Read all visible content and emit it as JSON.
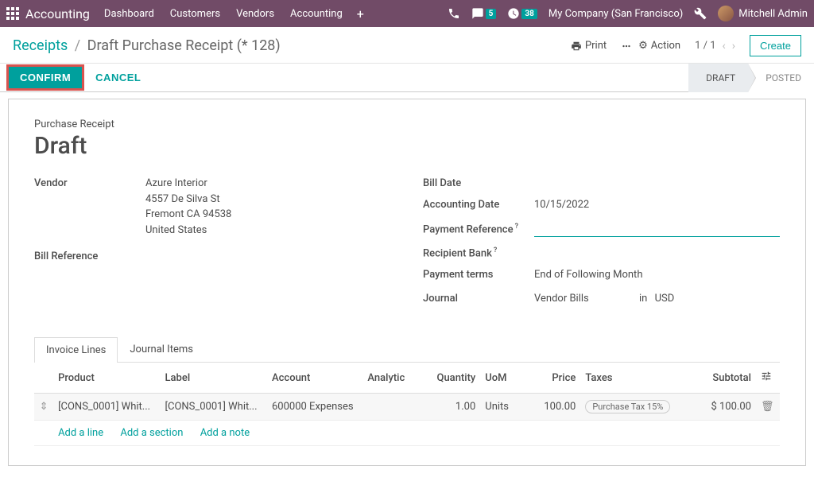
{
  "navbar": {
    "app": "Accounting",
    "menu": [
      "Dashboard",
      "Customers",
      "Vendors",
      "Accounting"
    ],
    "messages_badge": "5",
    "activities_badge": "38",
    "company": "My Company (San Francisco)",
    "user": "Mitchell Admin"
  },
  "breadcrumb": {
    "root": "Receipts",
    "current": "Draft Purchase Receipt (* 128)"
  },
  "controls": {
    "print": "Print",
    "action": "Action",
    "pager": "1 / 1",
    "create": "Create"
  },
  "buttons": {
    "confirm": "CONFIRM",
    "cancel": "CANCEL"
  },
  "status": {
    "draft": "DRAFT",
    "posted": "POSTED"
  },
  "form": {
    "doc_type": "Purchase Receipt",
    "doc_title": "Draft",
    "vendor_label": "Vendor",
    "vendor_name": "Azure Interior",
    "vendor_street": "4557 De Silva St",
    "vendor_city": "Fremont CA 94538",
    "vendor_country": "United States",
    "bill_ref_label": "Bill Reference",
    "bill_date_label": "Bill Date",
    "acc_date_label": "Accounting Date",
    "acc_date_value": "10/15/2022",
    "pay_ref_label": "Payment Reference",
    "pay_ref_value": "",
    "bank_label": "Recipient Bank",
    "terms_label": "Payment terms",
    "terms_value": "End of Following Month",
    "journal_label": "Journal",
    "journal_value": "Vendor Bills",
    "journal_in": "in",
    "journal_currency": "USD"
  },
  "tabs": {
    "invoice_lines": "Invoice Lines",
    "journal_items": "Journal Items"
  },
  "table": {
    "headers": {
      "product": "Product",
      "label": "Label",
      "account": "Account",
      "analytic": "Analytic",
      "quantity": "Quantity",
      "uom": "UoM",
      "price": "Price",
      "taxes": "Taxes",
      "subtotal": "Subtotal"
    },
    "row": {
      "product": "[CONS_0001] Whit...",
      "label": "[CONS_0001] Whit...",
      "account": "600000 Expenses",
      "analytic": "",
      "quantity": "1.00",
      "uom": "Units",
      "price": "100.00",
      "tax": "Purchase Tax 15%",
      "subtotal": "$ 100.00"
    },
    "add_line": "Add a line",
    "add_section": "Add a section",
    "add_note": "Add a note"
  }
}
